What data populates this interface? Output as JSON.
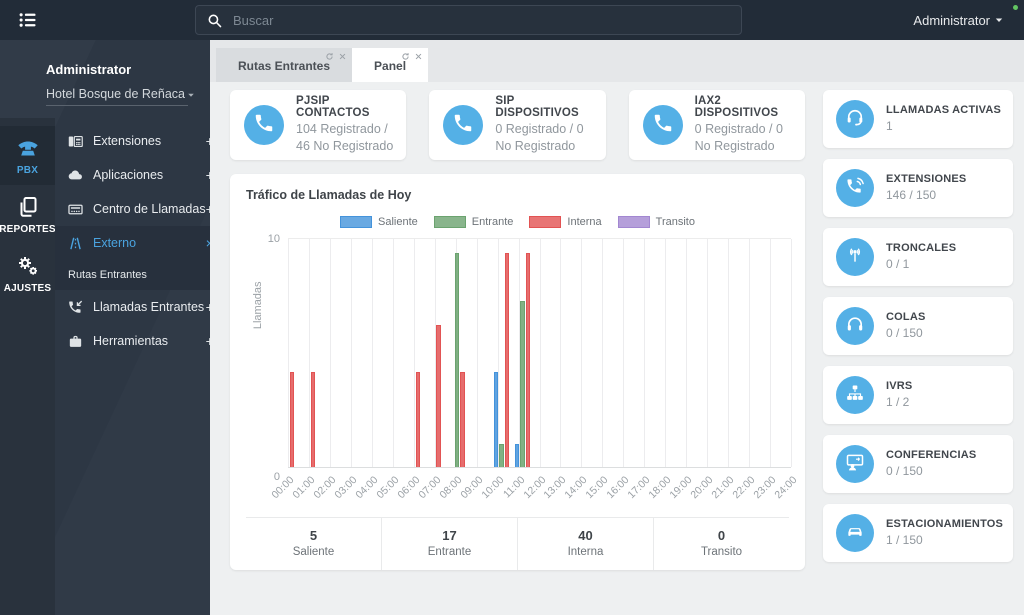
{
  "topbar": {
    "search_placeholder": "Buscar",
    "user_label": "Administrator"
  },
  "sidebar": {
    "user_title": "Administrator",
    "tenant": "Hotel Bosque de Reñaca",
    "rail": [
      {
        "id": "pbx",
        "label": "PBX",
        "icon": "pbx-phone-icon",
        "active": true
      },
      {
        "id": "reportes",
        "label": "REPORTES",
        "icon": "reports-icon",
        "active": false
      },
      {
        "id": "ajustes",
        "label": "AJUSTES",
        "icon": "gears-icon",
        "active": false
      }
    ],
    "menu": [
      {
        "id": "extensiones",
        "label": "Extensiones",
        "icon": "desk-phone-icon",
        "suffix": "+"
      },
      {
        "id": "aplicaciones",
        "label": "Aplicaciones",
        "icon": "apps-cloud-icon",
        "suffix": "+"
      },
      {
        "id": "centro-llamadas",
        "label": "Centro de Llamadas",
        "icon": "call-center-icon",
        "suffix": "+"
      },
      {
        "id": "externo",
        "label": "Externo",
        "icon": "road-icon",
        "suffix": "×",
        "active": true,
        "children": [
          {
            "id": "rutas-entrantes",
            "label": "Rutas Entrantes"
          }
        ]
      },
      {
        "id": "llamadas-entrantes",
        "label": "Llamadas Entrantes",
        "icon": "incoming-call-icon",
        "suffix": "+"
      },
      {
        "id": "herramientas",
        "label": "Herramientas",
        "icon": "tools-icon",
        "suffix": "+"
      }
    ]
  },
  "tabs": [
    {
      "label": "Rutas Entrantes",
      "active": false
    },
    {
      "label": "Panel",
      "active": true
    }
  ],
  "status_cards": [
    {
      "title": "PJSIP CONTACTOS",
      "value": "104 Registrado / 46 No Registrado",
      "icon": "phone-icon"
    },
    {
      "title": "SIP DISPOSITIVOS",
      "value": "0 Registrado / 0 No Registrado",
      "icon": "phone-icon"
    },
    {
      "title": "IAX2 DISPOSITIVOS",
      "value": "0 Registrado / 0 No Registrado",
      "icon": "phone-icon"
    }
  ],
  "right_cards": [
    {
      "title": "LLAMADAS ACTIVAS",
      "value": "1",
      "icon": "headset-icon"
    },
    {
      "title": "EXTENSIONES",
      "value": "146 / 150",
      "icon": "phone-waves-icon"
    },
    {
      "title": "TRONCALES",
      "value": "0 / 1",
      "icon": "antenna-icon"
    },
    {
      "title": "COLAS",
      "value": "0 / 150",
      "icon": "headphones-icon"
    },
    {
      "title": "IVRS",
      "value": "1 / 2",
      "icon": "sitemap-icon"
    },
    {
      "title": "CONFERENCIAS",
      "value": "0 / 150",
      "icon": "conference-icon"
    },
    {
      "title": "ESTACIONAMIENTOS",
      "value": "1 / 150",
      "icon": "car-icon"
    }
  ],
  "chart_data": {
    "type": "bar",
    "title": "Tráfico de Llamadas de Hoy",
    "ylabel": "Llamadas",
    "ylim": [
      0,
      10
    ],
    "grid": "vertical",
    "legend_position": "top-center",
    "categories": [
      "00:00",
      "01:00",
      "02:00",
      "03:00",
      "04:00",
      "05:00",
      "06:00",
      "07:00",
      "08:00",
      "09:00",
      "10:00",
      "11:00",
      "12:00",
      "13:00",
      "14:00",
      "15:00",
      "16:00",
      "17:00",
      "18:00",
      "19:00",
      "20:00",
      "21:00",
      "22:00",
      "23:00",
      "24:00"
    ],
    "series": [
      {
        "name": "Saliente",
        "color": "#4493db",
        "values": [
          0,
          0,
          0,
          0,
          0,
          0,
          0,
          0,
          0,
          0,
          4,
          1,
          0,
          0,
          0,
          0,
          0,
          0,
          0,
          0,
          0,
          0,
          0,
          0,
          0
        ]
      },
      {
        "name": "Entrante",
        "color": "#6ba36f",
        "values": [
          0,
          0,
          0,
          0,
          0,
          0,
          0,
          0,
          9,
          0,
          1,
          7,
          0,
          0,
          0,
          0,
          0,
          0,
          0,
          0,
          0,
          0,
          0,
          0,
          0
        ]
      },
      {
        "name": "Interna",
        "color": "#e25353",
        "values": [
          4,
          4,
          0,
          0,
          0,
          0,
          4,
          6,
          4,
          0,
          9,
          9,
          0,
          0,
          0,
          0,
          0,
          0,
          0,
          0,
          0,
          0,
          0,
          0,
          0
        ]
      },
      {
        "name": "Transito",
        "color": "#a287d1",
        "values": [
          0,
          0,
          0,
          0,
          0,
          0,
          0,
          0,
          0,
          0,
          0,
          0,
          0,
          0,
          0,
          0,
          0,
          0,
          0,
          0,
          0,
          0,
          0,
          0,
          0
        ]
      }
    ],
    "totals": [
      {
        "label": "Saliente",
        "value": "5"
      },
      {
        "label": "Entrante",
        "value": "17"
      },
      {
        "label": "Interna",
        "value": "40"
      },
      {
        "label": "Transito",
        "value": "0"
      }
    ]
  }
}
